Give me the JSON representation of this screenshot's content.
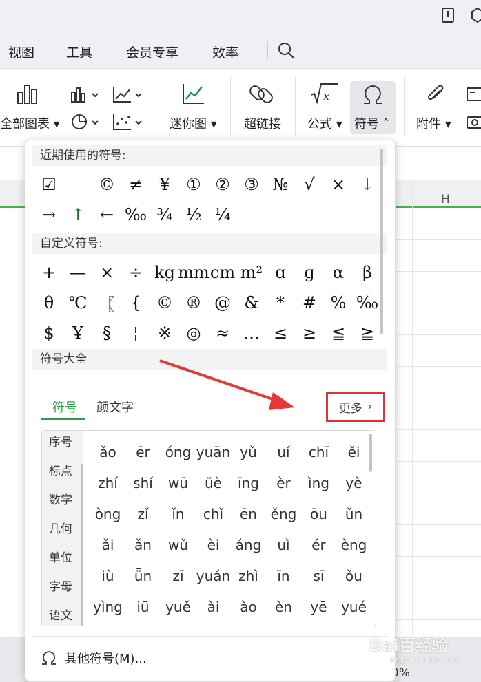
{
  "menu": [
    "视图",
    "工具",
    "会员专享",
    "效率"
  ],
  "ribbon": {
    "all_charts": "全部图表",
    "mini_chart": "迷你图",
    "hyperlink": "超链接",
    "formula": "公式",
    "symbol": "符号",
    "attachment": "附件"
  },
  "sheet": {
    "col_h": "H",
    "zoom": "0%"
  },
  "panel": {
    "recent_header": "近期使用的符号:",
    "recent_symbols": [
      "☑",
      "",
      "©",
      "≠",
      "¥",
      "①",
      "②",
      "③",
      "№",
      "√",
      "×",
      "↓",
      "→",
      "↑",
      "←",
      "‰",
      "¾",
      "½",
      "¼"
    ],
    "custom_header": "自定义符号:",
    "custom_symbols": [
      "+",
      "—",
      "×",
      "÷",
      "kg",
      "mm",
      "cm",
      "m²",
      "ɑ",
      "ɡ",
      "α",
      "β",
      "θ",
      "℃",
      "〖",
      "{",
      "©",
      "®",
      "@",
      "&",
      "*",
      "#",
      "%",
      "‰",
      "$",
      "Ұ",
      "§",
      "¦",
      "※",
      "◎",
      "≈",
      "…",
      "≤",
      "≥",
      "≦",
      "≧"
    ],
    "all_header": "符号大全",
    "tab_symbols": "符号",
    "tab_kaomoji": "颜文字",
    "more": "更多",
    "categories": [
      "序号",
      "标点",
      "数学",
      "几何",
      "单位",
      "字母",
      "语文"
    ],
    "pinyin": [
      "ǎo",
      "ēr",
      "óng",
      "yuān",
      "yǔ",
      "uí",
      "chī",
      "ěi",
      "zhí",
      "shí",
      "wū",
      "üè",
      "īng",
      "èr",
      "ìng",
      "yè",
      "òng",
      "zǐ",
      "ǐn",
      "chǐ",
      "ēn",
      "ěng",
      "ōu",
      "ǔn",
      "ǎi",
      "ǎn",
      "wǔ",
      "èi",
      "áng",
      "uì",
      "ér",
      "èng",
      "iù",
      "ǖn",
      "zī",
      "yuán",
      "zhì",
      "īn",
      "sī",
      "ǒu",
      "yìng",
      "iū",
      "yuě",
      "ài",
      "ào",
      "èn",
      "yē",
      "yué"
    ],
    "other_symbols": "其他符号(M)..."
  },
  "watermark": {
    "main": "Bai百经验",
    "sub": "jingyan.baidu.com"
  }
}
